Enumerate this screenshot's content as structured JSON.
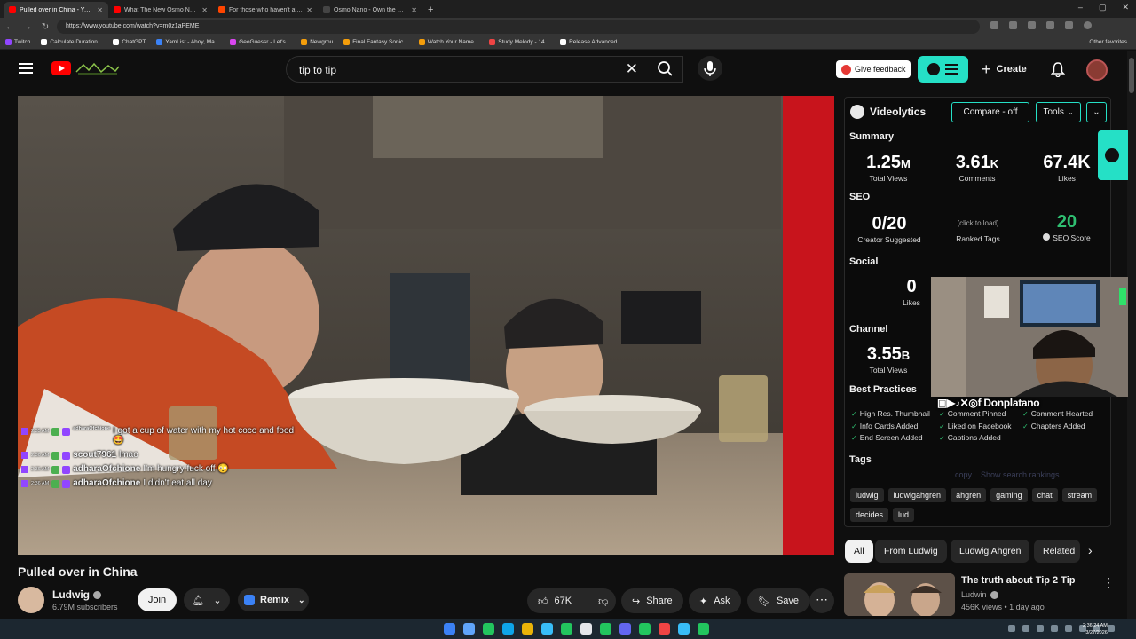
{
  "browser": {
    "tabs": [
      {
        "title": "Pulled over in China - YouTub",
        "active": true,
        "favicon_color": "#ff0000"
      },
      {
        "title": "What The New Osmo Nano is ACT",
        "active": false,
        "favicon_color": "#ff0000"
      },
      {
        "title": "For those who haven't already se",
        "active": false,
        "favicon_color": "#ff4500"
      },
      {
        "title": "Osmo Nano - Own the Moment -",
        "active": false,
        "favicon_color": "#444444"
      }
    ],
    "new_tab": "+",
    "window_controls": [
      "–",
      "▢",
      "✕"
    ],
    "url": "https://www.youtube.com/watch?v=m0z1aPEME",
    "bookmarks": [
      {
        "label": "Twitch",
        "color": "#9146ff"
      },
      {
        "label": "Calculate Duration...",
        "color": "#ffffff"
      },
      {
        "label": "ChatGPT",
        "color": "#ffffff"
      },
      {
        "label": "YamList - Ahoy, Ma...",
        "color": "#3b82f6"
      },
      {
        "label": "GeoGuessr - Let's...",
        "color": "#d946ef"
      },
      {
        "label": "Newgrou",
        "color": "#f59e0b"
      },
      {
        "label": "Final Fantasy Sonic...",
        "color": "#f59e0b"
      },
      {
        "label": "Watch Your Name...",
        "color": "#f59e0b"
      },
      {
        "label": "Study Melody - 14...",
        "color": "#ef4444"
      },
      {
        "label": "Release Advanced...",
        "color": "#ffffff"
      }
    ],
    "other_favorites": "Other favorites"
  },
  "header": {
    "search_query": "tip to tip",
    "give_feedback": "Give feedback",
    "create": "Create"
  },
  "video": {
    "title": "Pulled over in China",
    "chat": [
      {
        "time": "2:35 AM",
        "user": "adharaOfchione",
        "message": "I got a cup of water with my hot coco and food 🤩",
        "small_user": true
      },
      {
        "time": "2:36 AM",
        "user": "scout7961",
        "message": "lmao",
        "small_user": false
      },
      {
        "time": "2:36 AM",
        "user": "adharaOfchione",
        "message": "I'm hungry fuck off 😳",
        "small_user": false
      },
      {
        "time": "2:36 AM",
        "user": "adharaOfchione",
        "message": "I didn't eat all day",
        "small_user": false
      }
    ]
  },
  "channel": {
    "name": "Ludwig",
    "subscribers": "6.79M subscribers",
    "join": "Join",
    "remix": "Remix"
  },
  "actions": {
    "likes": "67K",
    "share": "Share",
    "ask": "Ask",
    "save": "Save"
  },
  "videolytics": {
    "title": "Videolytics",
    "compare": "Compare - off",
    "tools": "Tools",
    "summary_label": "Summary",
    "total_views": {
      "value": "1.25",
      "unit": "M",
      "label": "Total Views"
    },
    "comments": {
      "value": "3.61",
      "unit": "K",
      "label": "Comments"
    },
    "likes": {
      "value": "67.4K",
      "label": "Likes"
    },
    "seo_label": "SEO",
    "creator_suggested": {
      "value": "0/20",
      "label": "Creator Suggested"
    },
    "ranked_tags": {
      "hint": "(click to load)",
      "label": "Ranked Tags"
    },
    "seo_score": {
      "value": "20",
      "label": "SEO Score"
    },
    "social_label": "Social",
    "social_likes": {
      "value": "0",
      "label": "Likes"
    },
    "channel_label": "Channel",
    "channel_views": {
      "value": "3.55",
      "unit": "B",
      "label": "Total Views"
    },
    "best_practices_label": "Best Practices",
    "best_practices": [
      "High Res. Thumbnail",
      "Comment Pinned",
      "Comment Hearted",
      "Info Cards Added",
      "Liked on Facebook",
      "Chapters Added",
      "End Screen Added",
      "Captions Added"
    ],
    "tags_label": "Tags",
    "copy": "copy",
    "show_rankings": "Show search rankings",
    "tags": [
      "ludwig",
      "ludwigahgren",
      "ahgren",
      "gaming",
      "chat",
      "stream",
      "decides",
      "lud"
    ]
  },
  "overlay": {
    "streamer_tag": "Donplatano"
  },
  "chips": [
    "All",
    "From Ludwig",
    "Ludwig Ahgren",
    "Related"
  ],
  "recommendation": {
    "title": "The truth about Tip 2 Tip",
    "channel": "Ludwin",
    "meta": "456K views • 1 day ago"
  },
  "taskbar": {
    "time": "2:36:24 AM",
    "date": "3/27/2026",
    "icon_colors": [
      "#3b82f6",
      "#60a5fa",
      "#22c55e",
      "#0ea5e9",
      "#eab308",
      "#38bdf8",
      "#22c55e",
      "#e5e7eb",
      "#22c55e",
      "#6366f1",
      "#22c55e",
      "#ef4444",
      "#38bdf8",
      "#22c55e"
    ]
  },
  "colors": {
    "accent_teal": "#25e0c6",
    "yt_red": "#ff0000",
    "seo_green": "#2fbf71"
  }
}
